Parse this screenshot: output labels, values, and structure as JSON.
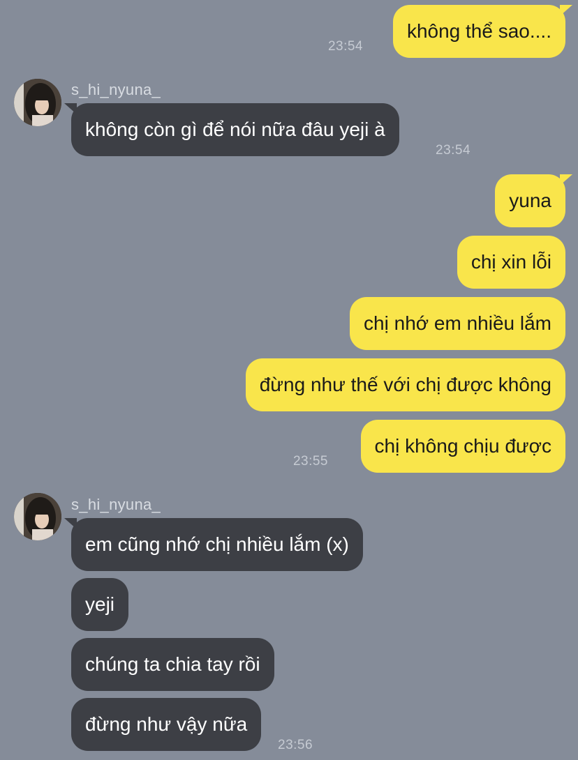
{
  "contact": {
    "username": "s_hi_nyuna_"
  },
  "messages": {
    "m1": {
      "text": "không thể sao....",
      "time": "23:54"
    },
    "m2": {
      "text": "không còn gì để nói nữa đâu yeji à",
      "time": "23:54"
    },
    "m3": {
      "text": "yuna"
    },
    "m4": {
      "text": "chị xin lỗi"
    },
    "m5": {
      "text": "chị nhớ em nhiều lắm"
    },
    "m6": {
      "text": "đừng như thế với chị được không"
    },
    "m7": {
      "text": "chị không chịu được",
      "time": "23:55"
    },
    "m8": {
      "text": "em cũng nhớ chị nhiều lắm (x)"
    },
    "m9": {
      "text": "yeji"
    },
    "m10": {
      "text": "chúng ta chia tay rồi"
    },
    "m11": {
      "text": "đừng như vậy nữa",
      "time": "23:56"
    }
  },
  "colors": {
    "background": "#858c99",
    "outgoing_bubble": "#f9e54b",
    "incoming_bubble": "#3d3f45",
    "timestamp": "#c6cbd3"
  },
  "icons": {
    "avatar": "profile-photo"
  }
}
